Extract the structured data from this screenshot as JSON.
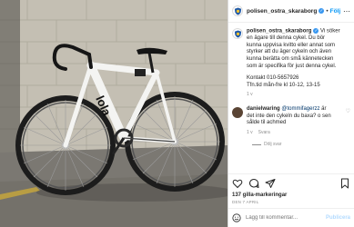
{
  "header": {
    "username": "polisen_ostra_skaraborg",
    "verified_glyph": "✓",
    "separator": "•",
    "follow_label": "Följ",
    "more_label": "⋯"
  },
  "caption": {
    "username": "polisen_ostra_skaraborg",
    "text": " Vi söker en ägare till denna cykel. Du bör kunna uppvisa kvitto eller annat som styrker att du äger cykeln och även kunna berätta om små kännetecken som är specifika för just denna cykel.",
    "contact_line1": "Kontakt 010-5657926",
    "contact_line2": "Tfn.tid mån-fre kl 10-12, 13-15",
    "age": "1 v"
  },
  "comment": {
    "username": "danielwaring",
    "mention": " @tommifagerzz",
    "text": " är det inte den cykeln du baxa? o sen sålde til achmed",
    "age": "1 v",
    "reply_label": "Svara",
    "view_replies_label": "Dölj svar"
  },
  "photo": {
    "frame_brand": "lola",
    "icon": "bicycle-photo"
  },
  "likes": "137 gilla-markeringar",
  "date": "DEN 7 APRIL",
  "add_comment": {
    "placeholder": "Lägg till kommentar...",
    "publish_label": "Publicera"
  },
  "colors": {
    "accent": "#0095f6",
    "verified": "#3897f0",
    "muted": "#8e8e8e",
    "text": "#262626"
  }
}
